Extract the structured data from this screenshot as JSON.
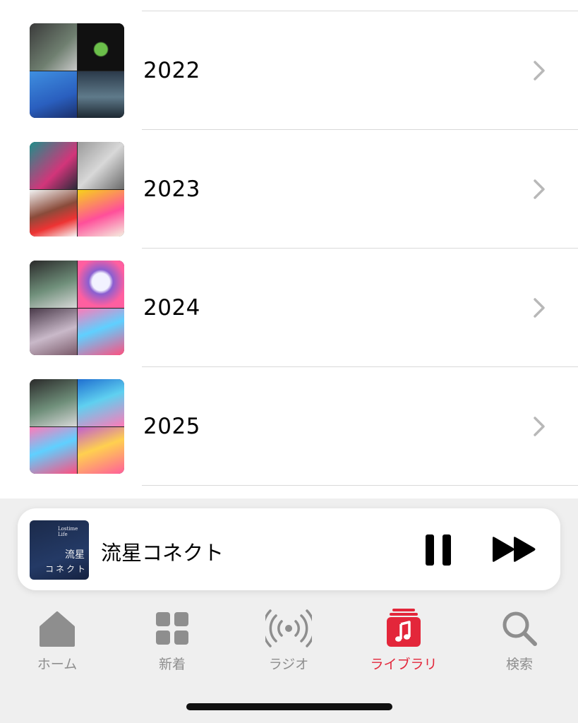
{
  "library": {
    "rows": [
      {
        "label": "2022"
      },
      {
        "label": "2023"
      },
      {
        "label": "2024"
      },
      {
        "label": "2025"
      }
    ]
  },
  "now_playing": {
    "title": "流星コネクト",
    "art_text_top": "Lostime Life",
    "art_text_mid": "流星",
    "art_text_bottom": "コネクト"
  },
  "tabs": [
    {
      "label": "ホーム",
      "icon": "home-icon"
    },
    {
      "label": "新着",
      "icon": "grid-icon"
    },
    {
      "label": "ラジオ",
      "icon": "radio-icon"
    },
    {
      "label": "ライブラリ",
      "icon": "library-icon",
      "active": true
    },
    {
      "label": "検索",
      "icon": "search-icon"
    }
  ],
  "colors": {
    "accent": "#e3263a",
    "tab_inactive": "#8e8e8e"
  }
}
